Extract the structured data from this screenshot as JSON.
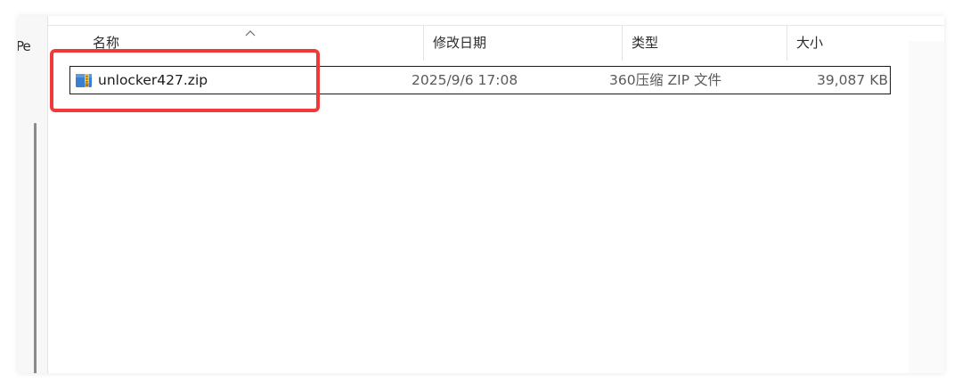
{
  "left_pane": {
    "truncated_label": "Pe"
  },
  "columns": {
    "name": "名称",
    "modified": "修改日期",
    "type": "类型",
    "size": "大小"
  },
  "files": [
    {
      "name": "unlocker427.zip",
      "modified": "2025/9/6 17:08",
      "type": "360压缩 ZIP 文件",
      "size": "39,087 KB",
      "icon": "zip-archive-icon"
    }
  ],
  "colors": {
    "highlight": "#ee3a3a",
    "text": "#1b1b1b",
    "secondary_text": "#5a5a5a"
  }
}
